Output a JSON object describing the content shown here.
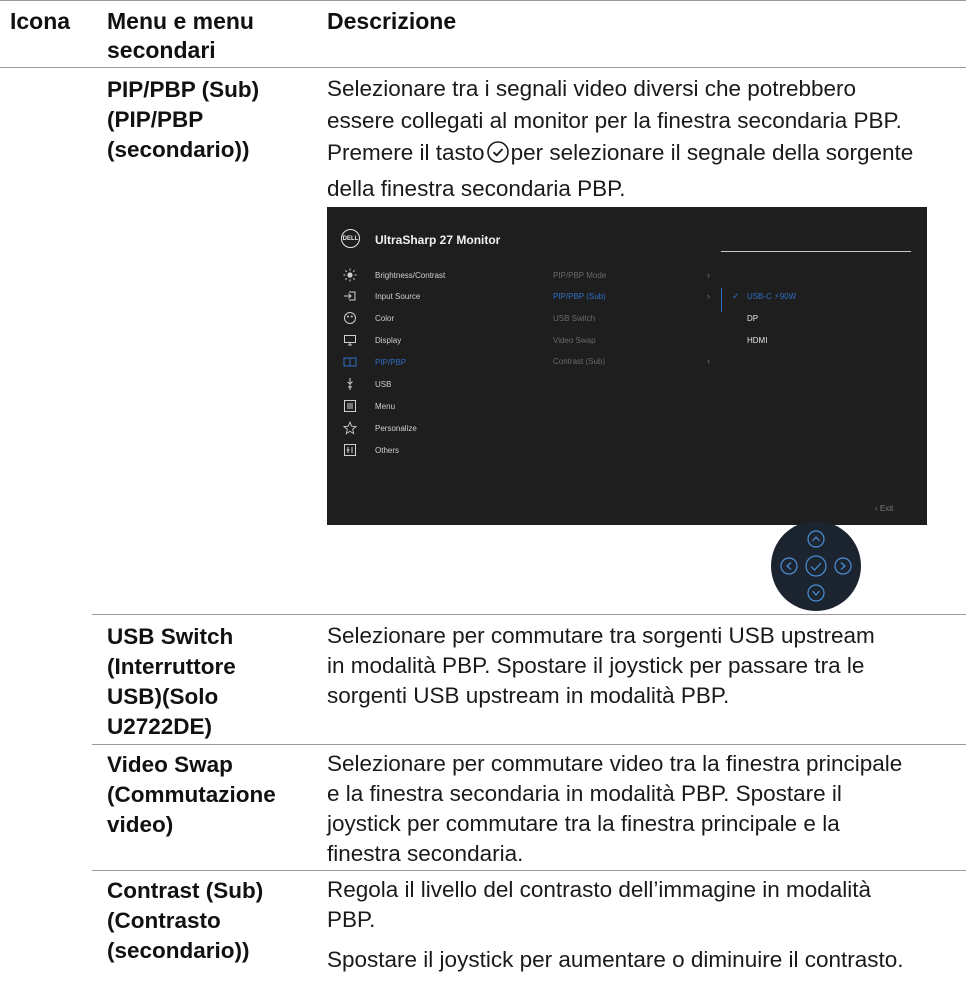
{
  "header": {
    "col_icon": "Icona",
    "col_menu_line1": "Menu e menu",
    "col_menu_line2": "secondari",
    "col_desc": "Descrizione"
  },
  "rows": [
    {
      "menu": [
        "PIP/PBP (Sub)",
        "(PIP/PBP",
        "(secondario))"
      ],
      "desc_lines": [
        "Selezionare tra i segnali video diversi che potrebbero",
        "essere collegati al monitor per la finestra secondaria PBP."
      ],
      "desc_pre_icon": "Premere il tasto",
      "desc_post_icon": "per selezionare il segnale della sorgente",
      "desc_last": "della finestra secondaria PBP."
    },
    {
      "menu": [
        "USB Switch",
        "(Interruttore",
        "USB)(Solo",
        "U2722DE)"
      ],
      "desc_lines": [
        "Selezionare per commutare tra sorgenti USB upstream",
        "in modalità PBP. Spostare il joystick per passare tra le",
        "sorgenti USB upstream in modalità PBP."
      ]
    },
    {
      "menu": [
        "Video Swap",
        "(Commutazione",
        "video)"
      ],
      "desc_lines": [
        "Selezionare per commutare video tra la finestra principale",
        "e la finestra secondaria in modalità PBP. Spostare il",
        "joystick per commutare tra la finestra principale e la",
        "finestra secondaria."
      ]
    },
    {
      "menu": [
        "Contrast (Sub)",
        "(Contrasto",
        "(secondario))"
      ],
      "desc_lines": [
        "Regola il livello del contrasto dell’immagine in modalità",
        "PBP."
      ],
      "desc_extra": "Spostare il joystick per aumentare o diminuire il contrasto."
    }
  ],
  "osd": {
    "logo": "DELL",
    "title": "UltraSharp 27 Monitor",
    "left_menu": [
      {
        "label": "Brightness/Contrast",
        "icon": "brightness-icon"
      },
      {
        "label": "Input Source",
        "icon": "input-source-icon"
      },
      {
        "label": "Color",
        "icon": "color-icon"
      },
      {
        "label": "Display",
        "icon": "display-icon"
      },
      {
        "label": "PIP/PBP",
        "icon": "pip-pbp-icon",
        "active": true
      },
      {
        "label": "USB",
        "icon": "usb-icon"
      },
      {
        "label": "Menu",
        "icon": "menu-icon"
      },
      {
        "label": "Personalize",
        "icon": "star-icon"
      },
      {
        "label": "Others",
        "icon": "others-icon"
      }
    ],
    "sub_menu": [
      {
        "label": "PIP/PBP Mode",
        "has_arrow": true
      },
      {
        "label": "PIP/PBP (Sub)",
        "has_arrow": true,
        "active": true
      },
      {
        "label": "USB Switch",
        "has_arrow": false
      },
      {
        "label": "Video Swap",
        "has_arrow": false
      },
      {
        "label": "Contrast (Sub)",
        "has_arrow": true
      }
    ],
    "options": [
      {
        "label": "USB-C ⚡90W",
        "active": true
      },
      {
        "label": "DP"
      },
      {
        "label": "HDMI"
      }
    ],
    "exit_label": "‹  Exit",
    "accent": "#2f6fc4",
    "background": "#1e1e1e"
  }
}
